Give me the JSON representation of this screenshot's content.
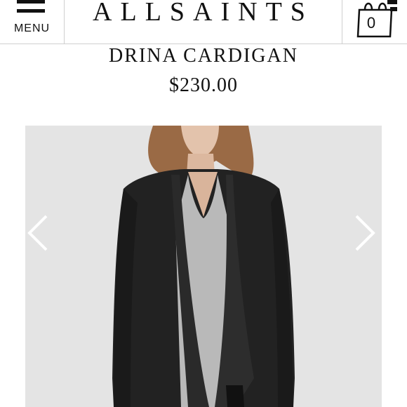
{
  "header": {
    "menu_label": "MENU",
    "logo": "ALLSAINTS",
    "bag_count": "0"
  },
  "product": {
    "title": "DRINA CARDIGAN",
    "price": "$230.00"
  },
  "gallery": {
    "image_icon": "product-photo",
    "prev_icon": "chevron-left-icon",
    "next_icon": "chevron-right-icon"
  },
  "colors": {
    "background": "#ffffff",
    "photo_background": "#e4e4e4",
    "divider": "#cfcfcf",
    "text": "#111111"
  }
}
